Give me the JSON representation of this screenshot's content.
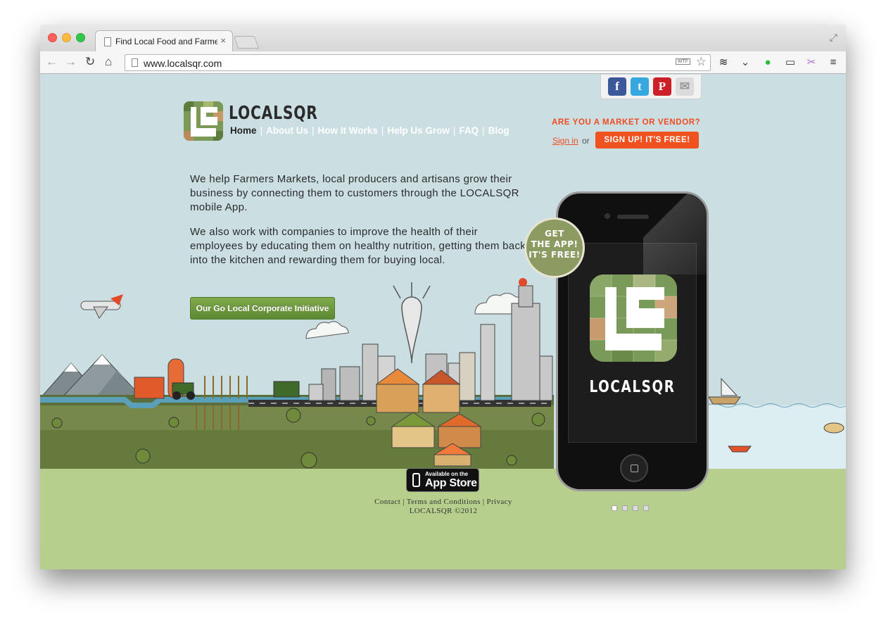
{
  "browser": {
    "tab_title": "Find Local Food and Farme",
    "tab_close": "×",
    "url": "www.localsqr.com",
    "url_badge": "WTF",
    "icons": [
      "back-icon",
      "forward-icon",
      "reload-icon",
      "home-icon",
      "star-icon",
      "layers-icon",
      "pocket-icon",
      "evernote-icon",
      "cast-icon",
      "scissors-icon",
      "menu-icon"
    ]
  },
  "share": {
    "facebook": "f",
    "twitter": "t",
    "pinterest": "P",
    "email": "✉"
  },
  "logo": {
    "text": "LOCALSQR"
  },
  "nav": {
    "items": [
      "Home",
      "About Us",
      "How It Works",
      "Help Us Grow",
      "FAQ",
      "Blog"
    ],
    "separator": "|"
  },
  "vendor": {
    "question": "ARE YOU A MARKET OR VENDOR?",
    "signin": "Sign in",
    "or": "or",
    "signup": "SIGN UP! IT'S FREE!"
  },
  "intro": {
    "p1": "We help Farmers Markets, local producers and artisans grow their business by connecting them to customers through the LOCALSQR mobile App.",
    "p2": "We also work with companies to improve the health of their employees by educating them on healthy nutrition, getting them back into the kitchen and rewarding them for buying local."
  },
  "corporate_button": "Our Go Local Corporate Initiative",
  "badge": {
    "line1": "GET",
    "line2": "THE APP!",
    "line3": "IT'S FREE!"
  },
  "phone": {
    "app_name": "LOCALSQR"
  },
  "pager": {
    "count": 4,
    "active": 0
  },
  "appstore": {
    "small": "Available on the",
    "big": "App Store"
  },
  "footer": {
    "links": [
      "Contact",
      "Terms and Conditions",
      "Privacy"
    ],
    "copyright": "LOCALSQR ©2012"
  },
  "colors": {
    "sky": "#cbdfe3",
    "ground": "#b6cf8d",
    "accent": "#f04b22",
    "button_green": "#6a9640",
    "badge": "#8b9b62"
  }
}
